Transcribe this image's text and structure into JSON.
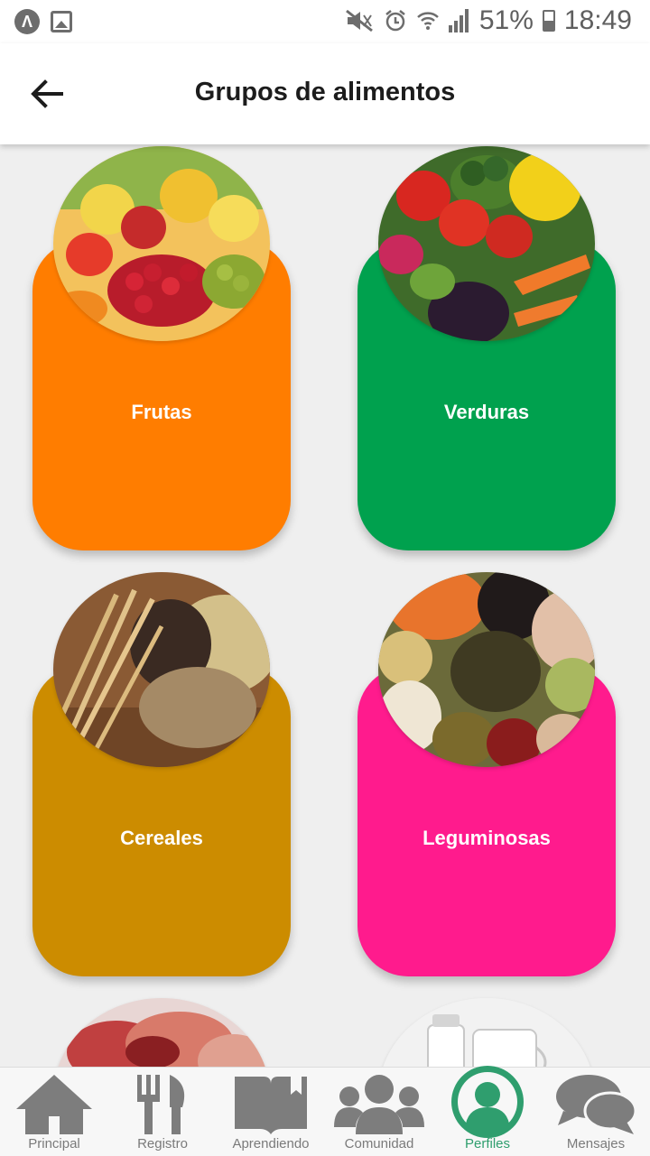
{
  "status_bar": {
    "app_glyph": "Λ",
    "battery_pct": "51%",
    "battery_level": 0.51,
    "time": "18:49"
  },
  "header": {
    "title": "Grupos de alimentos",
    "back_icon": "arrow-left-icon"
  },
  "food_groups": [
    {
      "label": "Frutas",
      "color": "#ff7d00",
      "image": "fruits"
    },
    {
      "label": "Verduras",
      "color": "#00a14e",
      "image": "vegetables"
    },
    {
      "label": "Cereales",
      "color": "#cc8c00",
      "image": "cereals"
    },
    {
      "label": "Leguminosas",
      "color": "#ff1b8d",
      "image": "legumes"
    }
  ],
  "bottom_nav": {
    "accent": "#2f9e6e",
    "items": [
      {
        "label": "Principal",
        "icon": "home-icon"
      },
      {
        "label": "Registro",
        "icon": "utensils-icon"
      },
      {
        "label": "Aprendiendo",
        "icon": "book-icon"
      },
      {
        "label": "Comunidad",
        "icon": "users-icon"
      },
      {
        "label": "Perfiles",
        "icon": "user-circle-icon",
        "active": true
      },
      {
        "label": "Mensajes",
        "icon": "chat-bubbles-icon"
      }
    ]
  }
}
